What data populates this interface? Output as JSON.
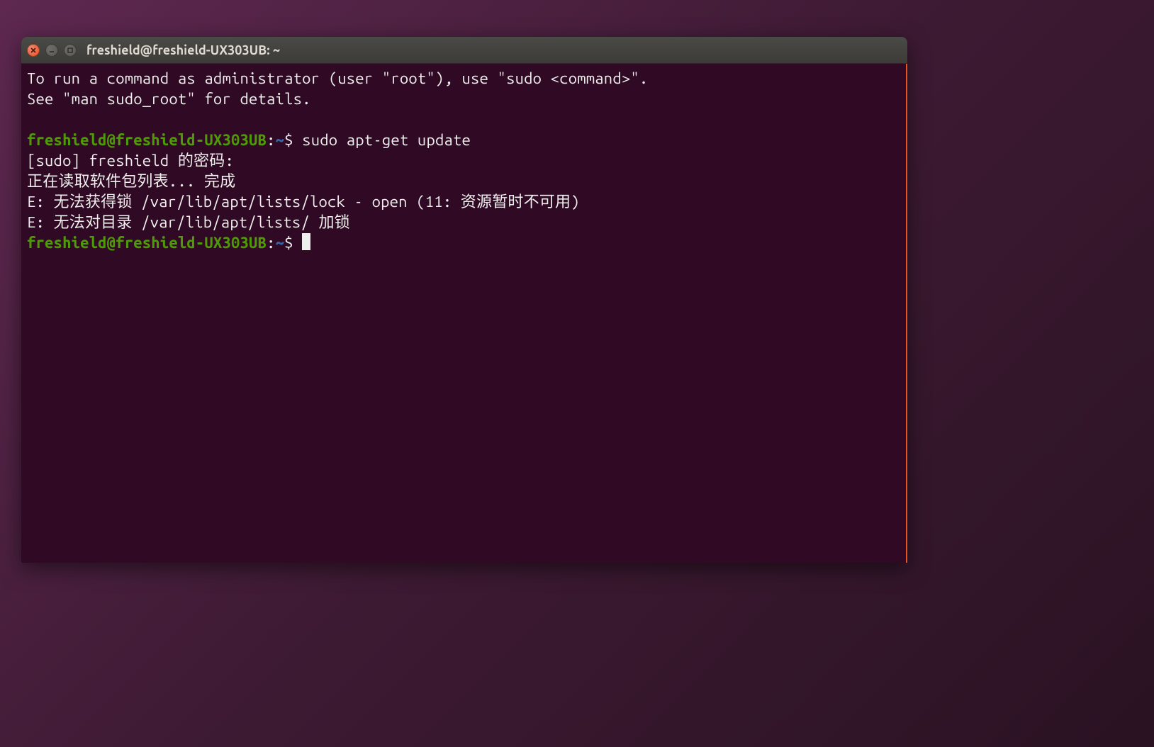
{
  "window": {
    "title": "freshield@freshield-UX303UB: ~"
  },
  "terminal": {
    "intro_line1": "To run a command as administrator (user \"root\"), use \"sudo <command>\".",
    "intro_line2": "See \"man sudo_root\" for details.",
    "prompt1": {
      "user_host": "freshield@freshield-UX303UB",
      "colon": ":",
      "path": "~",
      "symbol": "$",
      "command": "sudo apt-get update"
    },
    "output": {
      "line1": "[sudo] freshield 的密码:",
      "line2": "正在读取软件包列表... 完成",
      "line3": "E: 无法获得锁 /var/lib/apt/lists/lock - open (11: 资源暂时不可用)",
      "line4": "E: 无法对目录 /var/lib/apt/lists/ 加锁"
    },
    "prompt2": {
      "user_host": "freshield@freshield-UX303UB",
      "colon": ":",
      "path": "~",
      "symbol": "$"
    }
  }
}
